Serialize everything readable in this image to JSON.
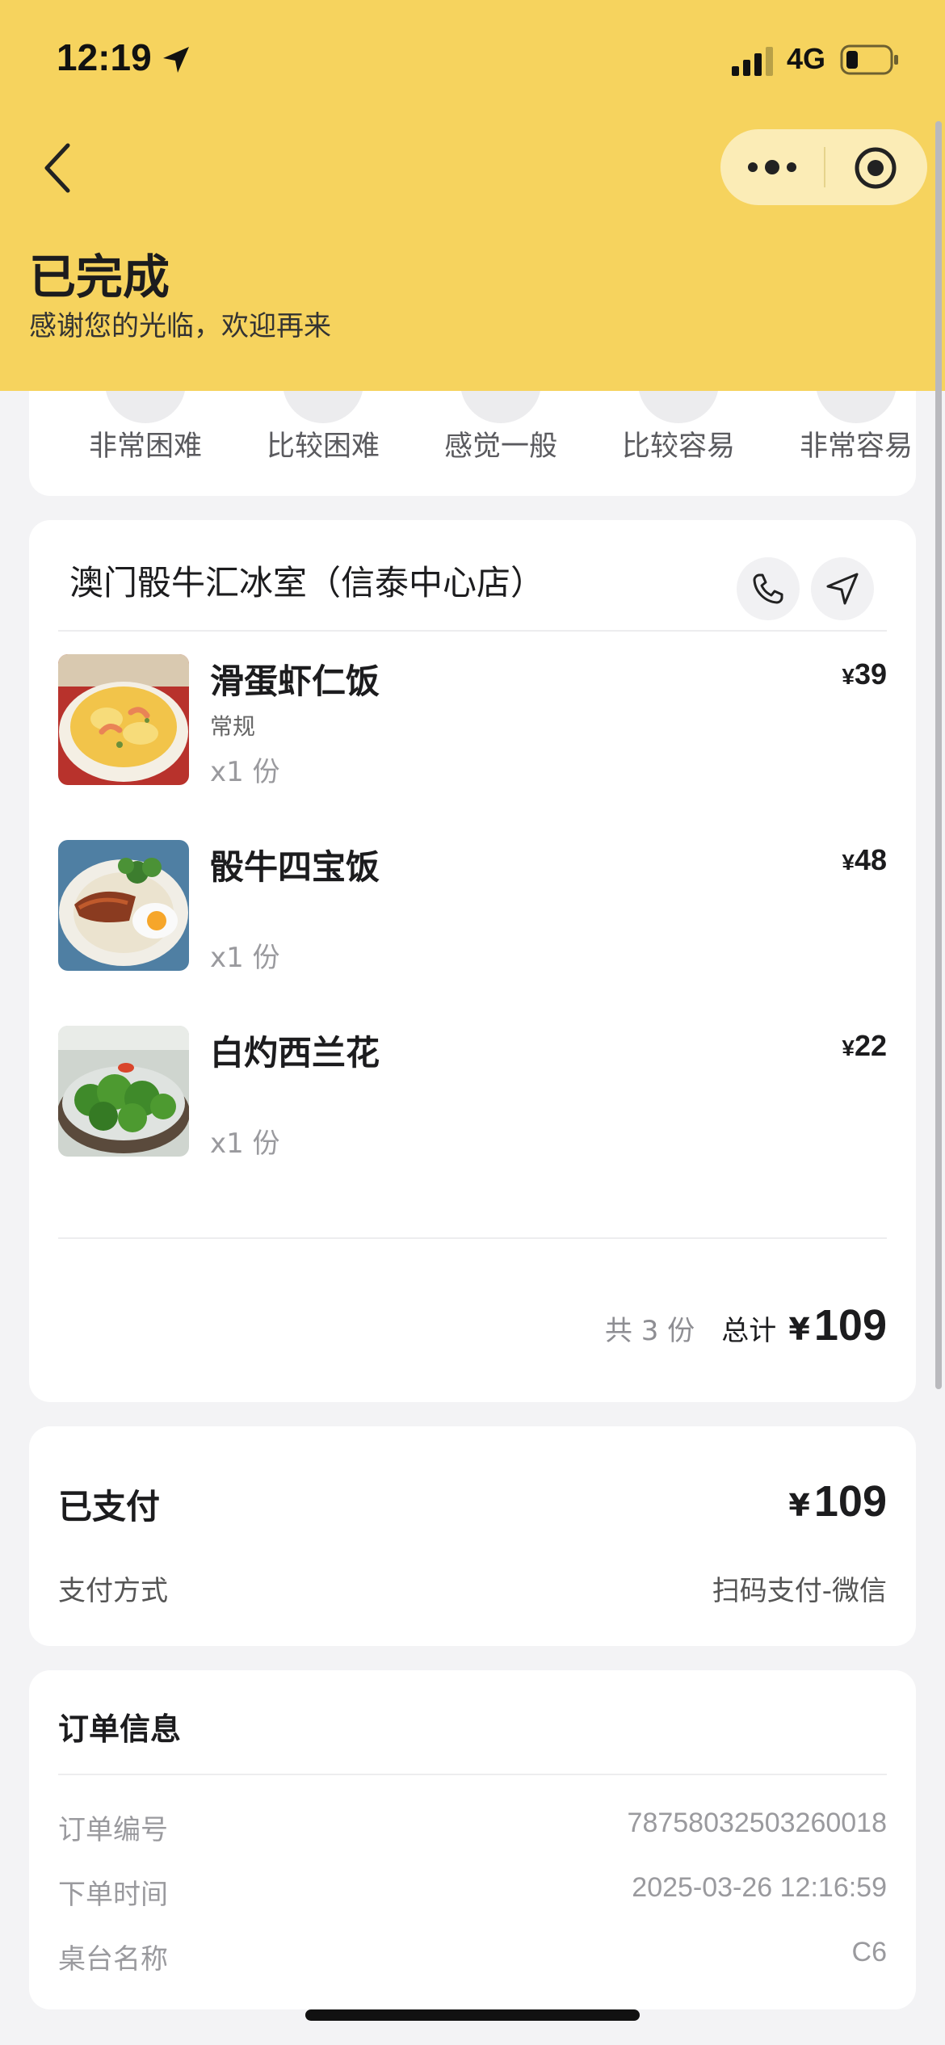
{
  "status_bar": {
    "time": "12:19",
    "network": "4G"
  },
  "header": {
    "status_title": "已完成",
    "status_subtitle": "感谢您的光临，欢迎再来"
  },
  "rating": {
    "options": [
      "非常困难",
      "比较困难",
      "感觉一般",
      "比较容易",
      "非常容易"
    ]
  },
  "order": {
    "shop_name": "澳门骰牛汇冰室（信泰中心店）",
    "items": [
      {
        "name": "滑蛋虾仁饭",
        "spec": "常规",
        "qty": "x1 份",
        "currency": "¥",
        "price": "39"
      },
      {
        "name": "骰牛四宝饭",
        "spec": "",
        "qty": "x1 份",
        "currency": "¥",
        "price": "48"
      },
      {
        "name": "白灼西兰花",
        "spec": "",
        "qty": "x1 份",
        "currency": "¥",
        "price": "22"
      }
    ],
    "summary": {
      "count": "共 3 份",
      "total_label": "总计",
      "currency": "¥",
      "total": "109"
    }
  },
  "payment": {
    "paid_label": "已支付",
    "currency": "¥",
    "paid_amount": "109",
    "method_label": "支付方式",
    "method_value": "扫码支付-微信"
  },
  "order_info": {
    "title": "订单信息",
    "rows": [
      {
        "label": "订单编号",
        "value": "78758032503260018"
      },
      {
        "label": "下单时间",
        "value": "2025-03-26 12:16:59"
      },
      {
        "label": "桌台名称",
        "value": "C6"
      }
    ]
  },
  "colors": {
    "header_bg": "#f6d35e",
    "page_bg": "#f3f3f5",
    "card_bg": "#ffffff"
  },
  "icons": [
    "location-arrow-icon",
    "signal-icon",
    "battery-icon",
    "back-chevron-icon",
    "more-dots-icon",
    "target-icon",
    "phone-icon",
    "navigation-icon"
  ]
}
